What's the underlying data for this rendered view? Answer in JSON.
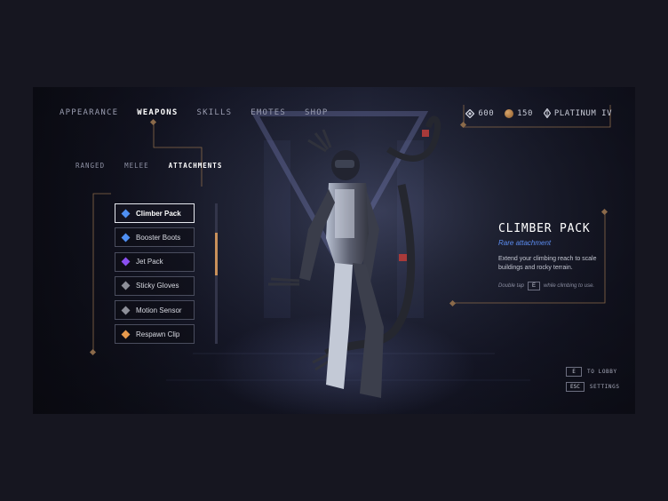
{
  "colors": {
    "accent_gold": "#c8905a",
    "rare_blue": "#5b8cf0",
    "selected_border": "#e6e8ef"
  },
  "nav": [
    {
      "label": "APPEARANCE",
      "active": false
    },
    {
      "label": "WEAPONS",
      "active": true
    },
    {
      "label": "SKILLS",
      "active": false
    },
    {
      "label": "EMOTES",
      "active": false
    },
    {
      "label": "SHOP",
      "active": false
    }
  ],
  "subnav": [
    {
      "label": "RANGED",
      "active": false
    },
    {
      "label": "MELEE",
      "active": false
    },
    {
      "label": "ATTACHMENTS",
      "active": true
    }
  ],
  "currency": {
    "gems": "600",
    "gems_icon": "gem-icon",
    "coins": "150",
    "coins_icon": "coin-icon",
    "rank": "PLATINUM IV",
    "rank_icon": "rank-badge-icon"
  },
  "items": [
    {
      "label": "Climber Pack",
      "color": "#4f8ff2",
      "selected": true
    },
    {
      "label": "Booster Boots",
      "color": "#4f8ff2",
      "selected": false
    },
    {
      "label": "Jet Pack",
      "color": "#8a4ff0",
      "selected": false
    },
    {
      "label": "Sticky Gloves",
      "color": "#8d8f98",
      "selected": false
    },
    {
      "label": "Motion Sensor",
      "color": "#8d8f98",
      "selected": false
    },
    {
      "label": "Respawn Clip",
      "color": "#e79a4d",
      "selected": false
    }
  ],
  "list_scroll_fraction": 0.3,
  "detail": {
    "title": "CLIMBER PACK",
    "rarity": "Rare attachment",
    "description": "Extend your climbing reach to scale buildings and rocky terrain.",
    "hint_before": "Double tap",
    "hint_key": "E",
    "hint_after": "while climbing to use."
  },
  "shortcuts": [
    {
      "key": "E",
      "label": "TO LOBBY"
    },
    {
      "key": "ESC",
      "label": "SETTINGS"
    }
  ]
}
